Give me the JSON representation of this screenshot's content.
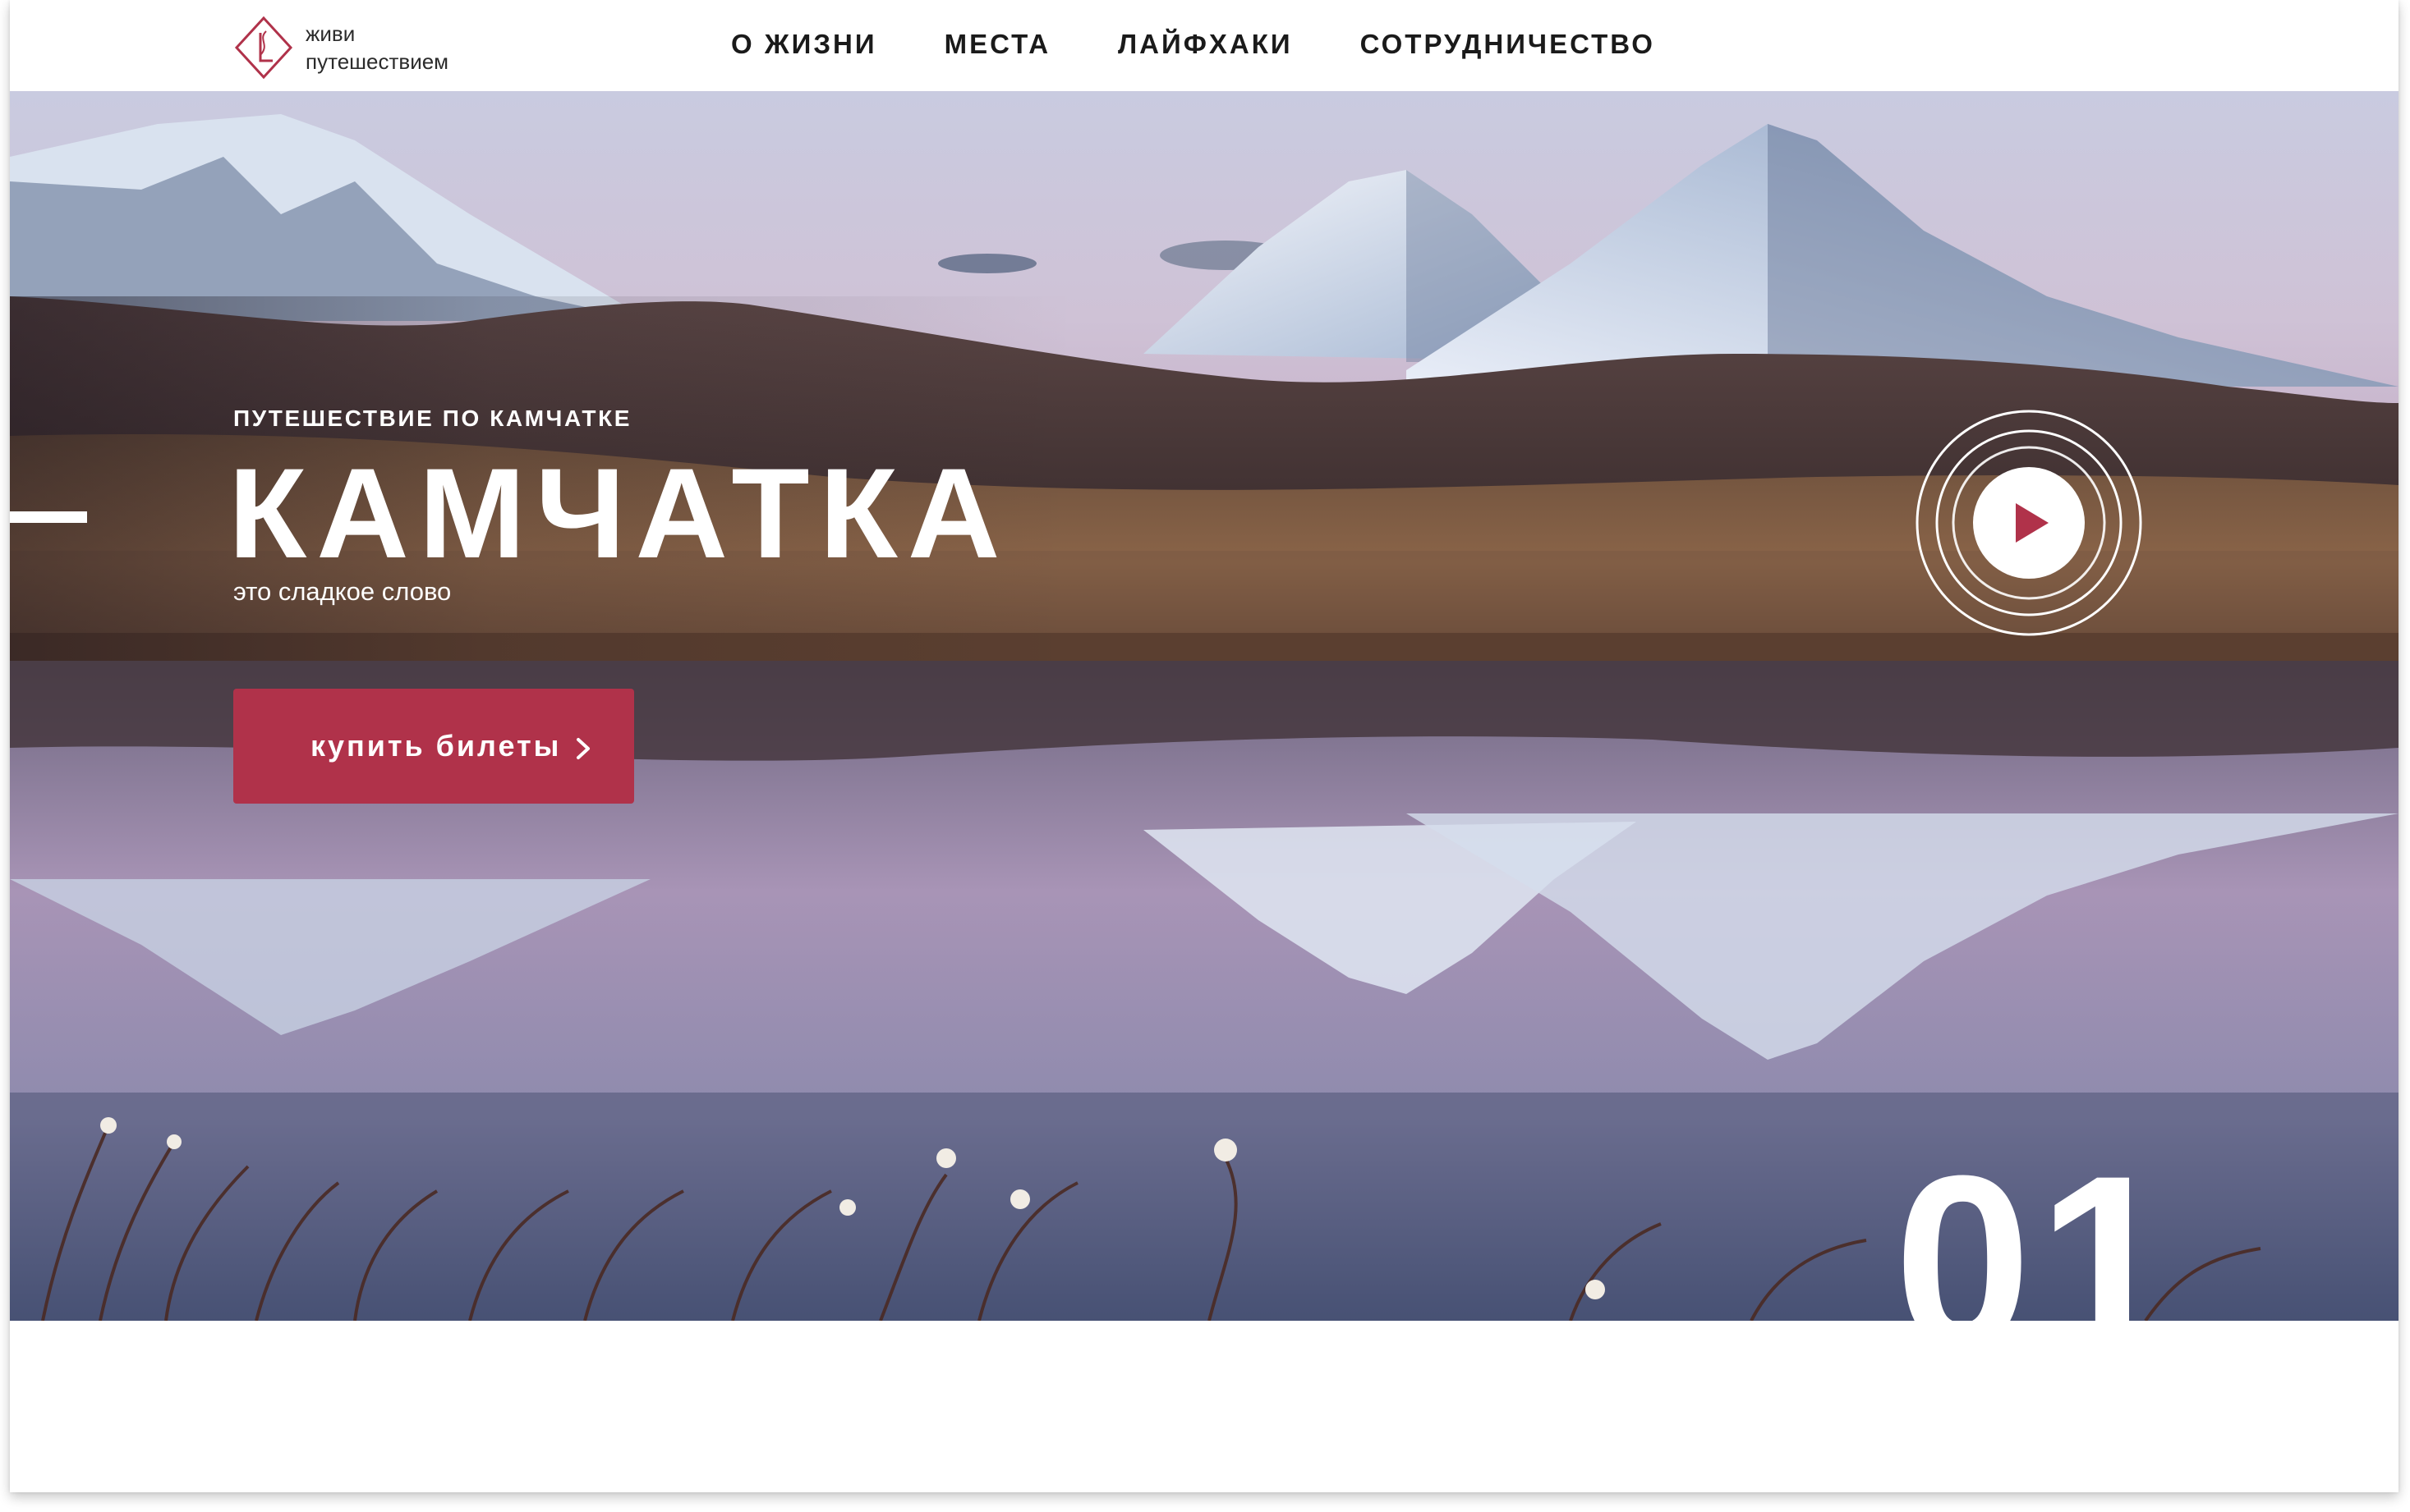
{
  "brand": {
    "line1": "живи",
    "line2": "путешествием",
    "accent_color": "#b0324a"
  },
  "nav": {
    "items": [
      {
        "label": "О ЖИЗНИ"
      },
      {
        "label": "МЕСТА"
      },
      {
        "label": "ЛАЙФХАКИ"
      },
      {
        "label": "СОТРУДНИЧЕСТВО"
      }
    ]
  },
  "hero": {
    "eyebrow": "ПУТЕШЕСТВИЕ ПО КАМЧАТКЕ",
    "title": "КАМЧАТКА",
    "subtitle": "это сладкое слово",
    "buy_label": "купить билеты",
    "buy_icon": "chevron-right-icon",
    "play_icon": "play-icon",
    "slide_number": "01",
    "button_color": "#b0324a"
  }
}
